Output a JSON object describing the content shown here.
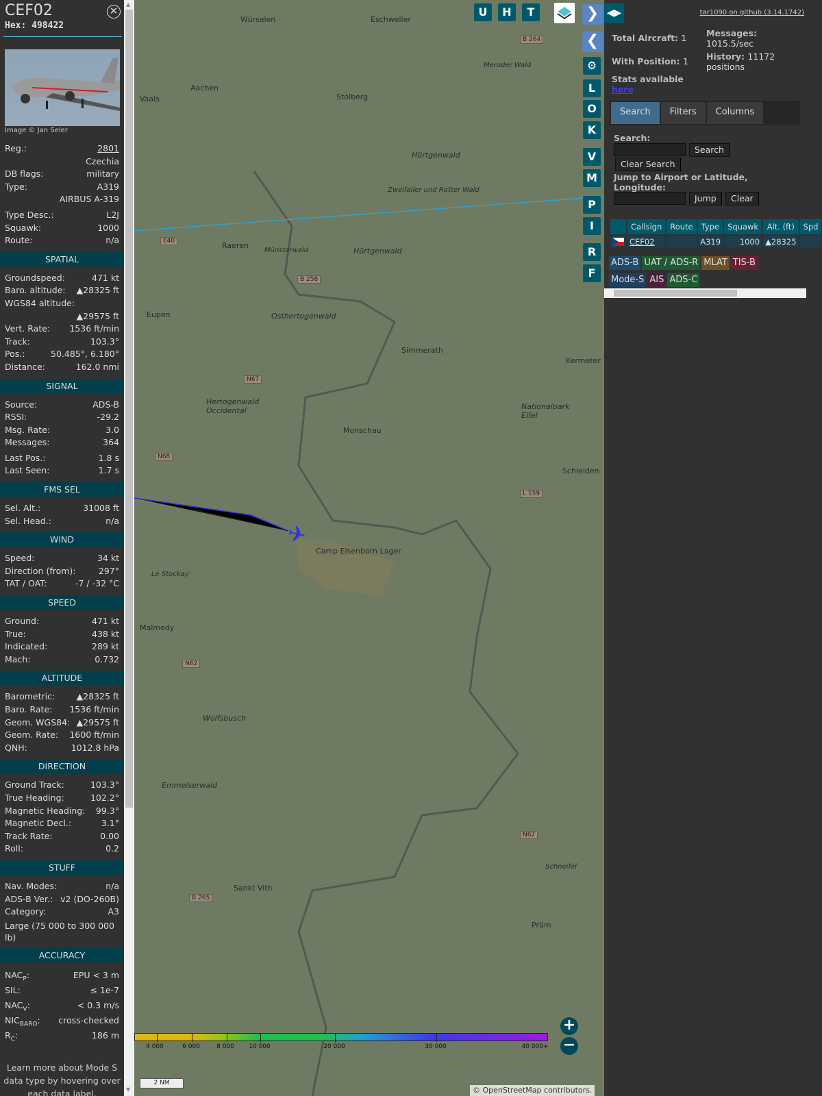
{
  "detail": {
    "callsign": "CEF02",
    "hex_label": "Hex:",
    "hex": "498422",
    "photo_credit": "Image © Jan Seler",
    "top_rows": [
      {
        "label": "Reg.:",
        "value": "2801"
      },
      {
        "label": "",
        "value": "Czechia"
      },
      {
        "label": "DB flags:",
        "value": "military"
      },
      {
        "label": "Type:",
        "value": "A319"
      },
      {
        "label": "",
        "value": "AIRBUS A-319"
      },
      {
        "label": "Type Desc.:",
        "value": "L2J"
      },
      {
        "label": "Squawk:",
        "value": "1000"
      },
      {
        "label": "Route:",
        "value": "n/a"
      }
    ],
    "sections": [
      {
        "title": "SPATIAL",
        "rows": [
          {
            "label": "Groundspeed:",
            "value": "471 kt"
          },
          {
            "label": "Baro. altitude:",
            "value": "▲28325 ft"
          },
          {
            "label": "WGS84 altitude:",
            "value": ""
          },
          {
            "label": "",
            "value": "▲29575 ft"
          },
          {
            "label": "Vert. Rate:",
            "value": "1536 ft/min"
          },
          {
            "label": "Track:",
            "value": "103.3°"
          },
          {
            "label": "Pos.:",
            "value": "50.485°, 6.180°"
          },
          {
            "label": "Distance:",
            "value": "162.0 nmi"
          }
        ]
      },
      {
        "title": "SIGNAL",
        "rows": [
          {
            "label": "Source:",
            "value": "ADS-B"
          },
          {
            "label": "RSSI:",
            "value": "-29.2"
          },
          {
            "label": "Msg. Rate:",
            "value": "3.0"
          },
          {
            "label": "Messages:",
            "value": "364"
          },
          {
            "label": "Last Pos.:",
            "value": "1.8 s"
          },
          {
            "label": "Last Seen:",
            "value": "1.7 s"
          }
        ]
      },
      {
        "title": "FMS SEL",
        "rows": [
          {
            "label": "Sel. Alt.:",
            "value": "31008 ft"
          },
          {
            "label": "Sel. Head.:",
            "value": "n/a"
          }
        ]
      },
      {
        "title": "WIND",
        "rows": [
          {
            "label": "Speed:",
            "value": "34 kt"
          },
          {
            "label": "Direction (from):",
            "value": "297°"
          },
          {
            "label": "TAT / OAT:",
            "value": "-7 / -32 °C"
          }
        ]
      },
      {
        "title": "SPEED",
        "rows": [
          {
            "label": "Ground:",
            "value": "471 kt"
          },
          {
            "label": "True:",
            "value": "438 kt"
          },
          {
            "label": "Indicated:",
            "value": "289 kt"
          },
          {
            "label": "Mach:",
            "value": "0.732"
          }
        ]
      },
      {
        "title": "ALTITUDE",
        "rows": [
          {
            "label": "Barometric:",
            "value": "▲28325 ft"
          },
          {
            "label": "Baro. Rate:",
            "value": "1536 ft/min"
          },
          {
            "label": "Geom. WGS84:",
            "value": "▲29575 ft"
          },
          {
            "label": "Geom. Rate:",
            "value": "1600 ft/min"
          },
          {
            "label": "QNH:",
            "value": "1012.8 hPa"
          }
        ]
      },
      {
        "title": "DIRECTION",
        "rows": [
          {
            "label": "Ground Track:",
            "value": "103.3°"
          },
          {
            "label": "True Heading:",
            "value": "102.2°"
          },
          {
            "label": "Magnetic Heading:",
            "value": "99.3°"
          },
          {
            "label": "Magnetic Decl.:",
            "value": "3.1°"
          },
          {
            "label": "Track Rate:",
            "value": "0.00"
          },
          {
            "label": "Roll:",
            "value": "0.2"
          }
        ]
      },
      {
        "title": "STUFF",
        "rows": [
          {
            "label": "Nav. Modes:",
            "value": "n/a"
          },
          {
            "label": "ADS-B Ver.:",
            "value": "v2 (DO-260B)"
          },
          {
            "label": "Category:",
            "value": "A3"
          }
        ],
        "note": "Large (75 000 to 300 000 lb)"
      }
    ],
    "accuracy": {
      "title": "ACCURACY",
      "nacp_label": "NAC",
      "nacp_sub": "P",
      "nacp": "EPU < 3 m",
      "sil_label": "SIL:",
      "sil": "≤ 1e-7",
      "nacv_label": "NAC",
      "nacv_sub": "V",
      "nacv": "< 0.3 m/s",
      "nic_label": "NIC",
      "nic_sub": "BARO",
      "nic": "cross-checked",
      "rc_label": "R",
      "rc_sub": "C",
      "rc": "186 m"
    },
    "footer_note": "Learn more about Mode S data type by hovering over each data label."
  },
  "map": {
    "top_buttons": [
      "U",
      "H",
      "T"
    ],
    "side_buttons": [
      "L",
      "O",
      "K",
      "V",
      "M",
      "P",
      "I",
      "R",
      "F"
    ],
    "labels": [
      "Würselen",
      "Eschweiler",
      "Aachen",
      "Vaals",
      "Stolberg",
      "Hürtgenwald",
      "Raeren",
      "Hürtgenwald",
      "Eupen",
      "Osthertogenwald",
      "Simmerath",
      "Kermeter",
      "Hertogenwald Occidental",
      "Nationalpark Eifel",
      "Monschau",
      "Schleiden",
      "Camp Elsenborn Lager",
      "Malmedy",
      "Wolfsbusch",
      "Emmelserwald",
      "Sankt Vith",
      "Prüm",
      "Meroder Wald",
      "Zweifaller und Rotter Wald",
      "Münsterwald",
      "Le Stockay",
      "Schneifel"
    ],
    "roads": [
      "B 264",
      "E40",
      "B 258",
      "N67",
      "N68",
      "L 159",
      "N62",
      "B 265",
      "N62"
    ],
    "legend": [
      "4 000",
      "6 000",
      "8 000",
      "10 000",
      "20 000",
      "30 000",
      "40 000+"
    ],
    "scale": "2 NM",
    "attribution_prefix": "© ",
    "attribution_link": "OpenStreetMap",
    "attribution_suffix": " contributors."
  },
  "right": {
    "github": "tar1090 on github (3.14.1742)",
    "total_label": "Total Aircraft:",
    "total": "1",
    "pos_label": "With Position:",
    "pos": "1",
    "stats_label": "Stats available",
    "stats_link": "here",
    "msg_label": "Messages:",
    "msg": "1015.5/sec",
    "hist_label": "History:",
    "hist": "11172",
    "hist_unit": "positions",
    "tabs": [
      "Search",
      "Filters",
      "Columns"
    ],
    "search_label": "Search:",
    "search_btn": "Search",
    "clear_search": "Clear Search",
    "jump_label": "Jump to Airport or Latitude, Longitude:",
    "jump_btn": "Jump",
    "clear_btn": "Clear",
    "columns": [
      "",
      "Callsign",
      "Route",
      "Type",
      "Squawk",
      "Alt. (ft)",
      "Spd"
    ],
    "rows": [
      {
        "callsign": "CEF02",
        "route": "",
        "type": "A319",
        "squawk": "1000",
        "alt": "▲28325",
        "spd": ""
      }
    ],
    "sources": [
      {
        "label": "ADS-B",
        "color": "#1f4a6b"
      },
      {
        "label": "UAT / ADS-R",
        "color": "#1f5a32"
      },
      {
        "label": "MLAT",
        "color": "#6b5028"
      },
      {
        "label": "TIS-B",
        "color": "#6b1f35"
      },
      {
        "label": "Mode-S",
        "color": "#1f3f60"
      },
      {
        "label": "AIS",
        "color": "#4a1f3f"
      },
      {
        "label": "ADS-C",
        "color": "#1f5a32"
      }
    ]
  }
}
